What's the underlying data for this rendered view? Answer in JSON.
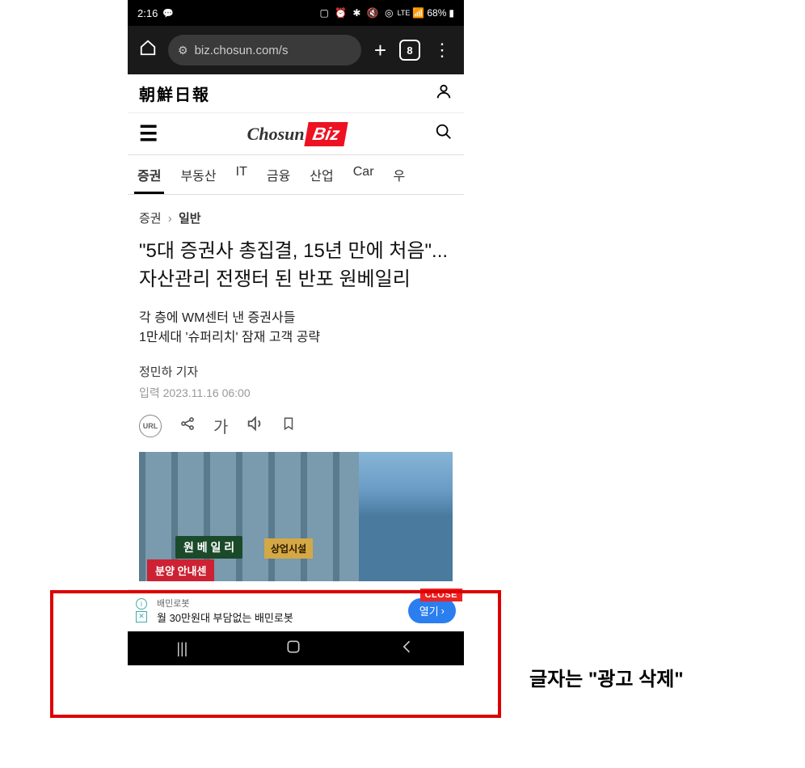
{
  "status": {
    "time": "2:16",
    "msg_icon": "💬",
    "icons": "⏰ 🔔 ✱ 🔇 ⊚",
    "network": "LTE",
    "signal": "📶",
    "battery": "68%"
  },
  "browser": {
    "url": "biz.chosun.com/s",
    "tab_count": "8"
  },
  "header": {
    "newspaper": "朝鮮日報"
  },
  "logo": {
    "chosun": "Chosun",
    "biz": "Biz"
  },
  "tabs": [
    {
      "label": "증권",
      "active": true
    },
    {
      "label": "부동산",
      "active": false
    },
    {
      "label": "IT",
      "active": false
    },
    {
      "label": "금융",
      "active": false
    },
    {
      "label": "산업",
      "active": false
    },
    {
      "label": "Car",
      "active": false
    },
    {
      "label": "우",
      "active": false
    }
  ],
  "breadcrumb": {
    "parent": "증권",
    "current": "일반"
  },
  "article": {
    "headline": "\"5대 증권사 총집결, 15년 만에 처음\"... 자산관리 전쟁터 된 반포 원베일리",
    "subhead_line1": "각 층에 WM센터 낸 증권사들",
    "subhead_line2": "1만세대 '슈퍼리치' 잠재 고객 공략",
    "byline": "정민하 기자",
    "timestamp": "입력 2023.11.16 06:00"
  },
  "toolbar": {
    "url": "URL",
    "font": "가"
  },
  "image_signs": {
    "sign1": "원 베 일 리",
    "sign1b": "상업시설",
    "sign2": "분양 안내센"
  },
  "ad": {
    "title": "배민로봇",
    "desc": "월 30만원대 부담없는 배민로봇",
    "open": "열기",
    "close": "CLOSE"
  },
  "annotation": {
    "text": "글자는 \"광고 삭제\""
  }
}
